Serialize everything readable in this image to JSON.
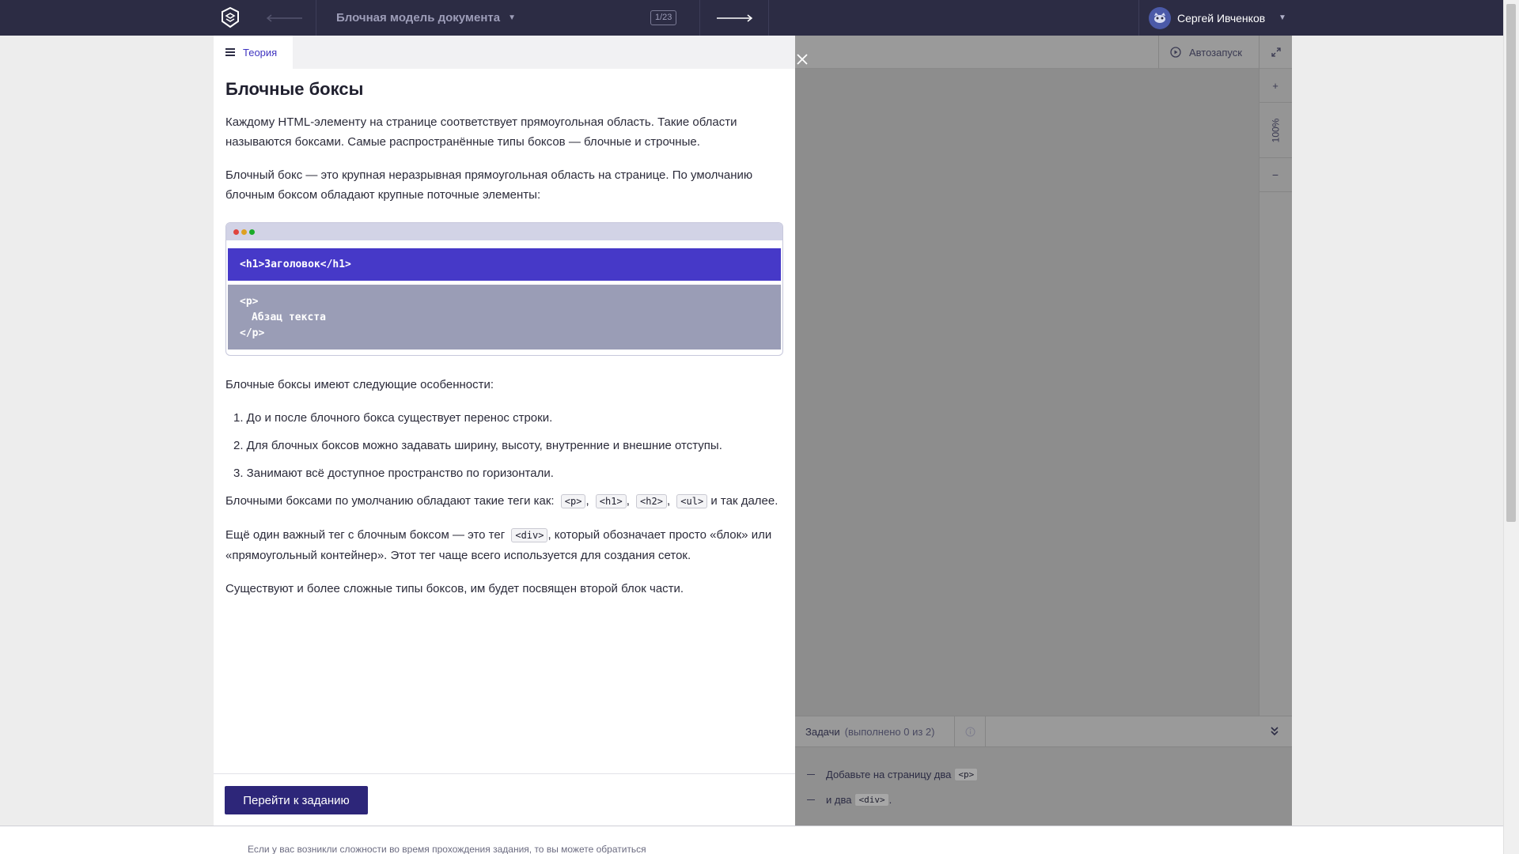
{
  "header": {
    "course_title": "Блочная модель документа",
    "counter": "1/23",
    "user_name": "Сергей Ивченков"
  },
  "theory_tab": {
    "label": "Теория"
  },
  "theory": {
    "title": "Блочные боксы",
    "p1": "Каждому HTML-элементу на странице соответствует прямоугольная область. Такие области называются боксами. Самые распространённые типы боксов — блочные и строчные.",
    "p2": "Блочный бокс — это крупная неразрывная прямоугольная область на странице. По умолчанию блочным боксом обладают крупные поточные элементы:",
    "demo": {
      "h1_code": "<h1>Заголовок</h1>",
      "p_open": "<p>",
      "p_text": "Абзац текста",
      "p_close": "</p>"
    },
    "p3": "Блочные боксы имеют следующие особенности:",
    "features": [
      "1. До и после блочного бокса существует перенос строки.",
      "2. Для блочных боксов можно задавать ширину, высоту, внутренние и внешние отступы.",
      "3. Занимают всё доступное пространство по горизонтали."
    ],
    "p4_before": "Блочными боксами по умолчанию обладают такие теги как: ",
    "p4_tags": [
      "<p>",
      "<h1>",
      "<h2>",
      "<ul>"
    ],
    "p4_sep": ", ",
    "p4_after": " и так далее.",
    "p5_before": "Ещё один важный тег с блочным боксом — это тег ",
    "p5_tag": "<div>",
    "p5_after": ", который обозначает просто «блок» или «прямоугольный контейнер». Этот тег чаще всего используется для создания сеток.",
    "p6": "Существуют и более сложные типы боксов, им будет посвящен второй блок части.",
    "goto_button": "Перейти к заданию"
  },
  "editor": {
    "autorun_label": "Автозапуск",
    "zoom_plus": "+",
    "zoom_value": "100%",
    "zoom_minus": "−"
  },
  "tasks": {
    "label": "Задачи",
    "progress": "(выполнено 0 из 2)",
    "items": [
      {
        "text": "Добавьте на страницу два",
        "code": "<p>",
        "tail": ""
      },
      {
        "text": "и два",
        "code": "<div>",
        "tail": "."
      }
    ]
  },
  "help_text": "Если у вас возникли сложности во время прохождения задания, то вы можете обратиться",
  "colors": {
    "header_bg": "#2c2c44",
    "accent": "#4639c8",
    "button_bg": "#2d2679",
    "dot_red": "#e0443e",
    "dot_yellow": "#dea123",
    "dot_green": "#1aab29"
  },
  "icons": {
    "logo": "academy-logo-icon",
    "back": "arrow-left-icon",
    "forward": "arrow-right-icon",
    "dropdown": "chevron-down-icon",
    "close": "close-icon",
    "autorun": "play-circle-icon",
    "expand": "expand-icon",
    "info": "info-icon",
    "collapse": "double-chevron-down-icon"
  }
}
